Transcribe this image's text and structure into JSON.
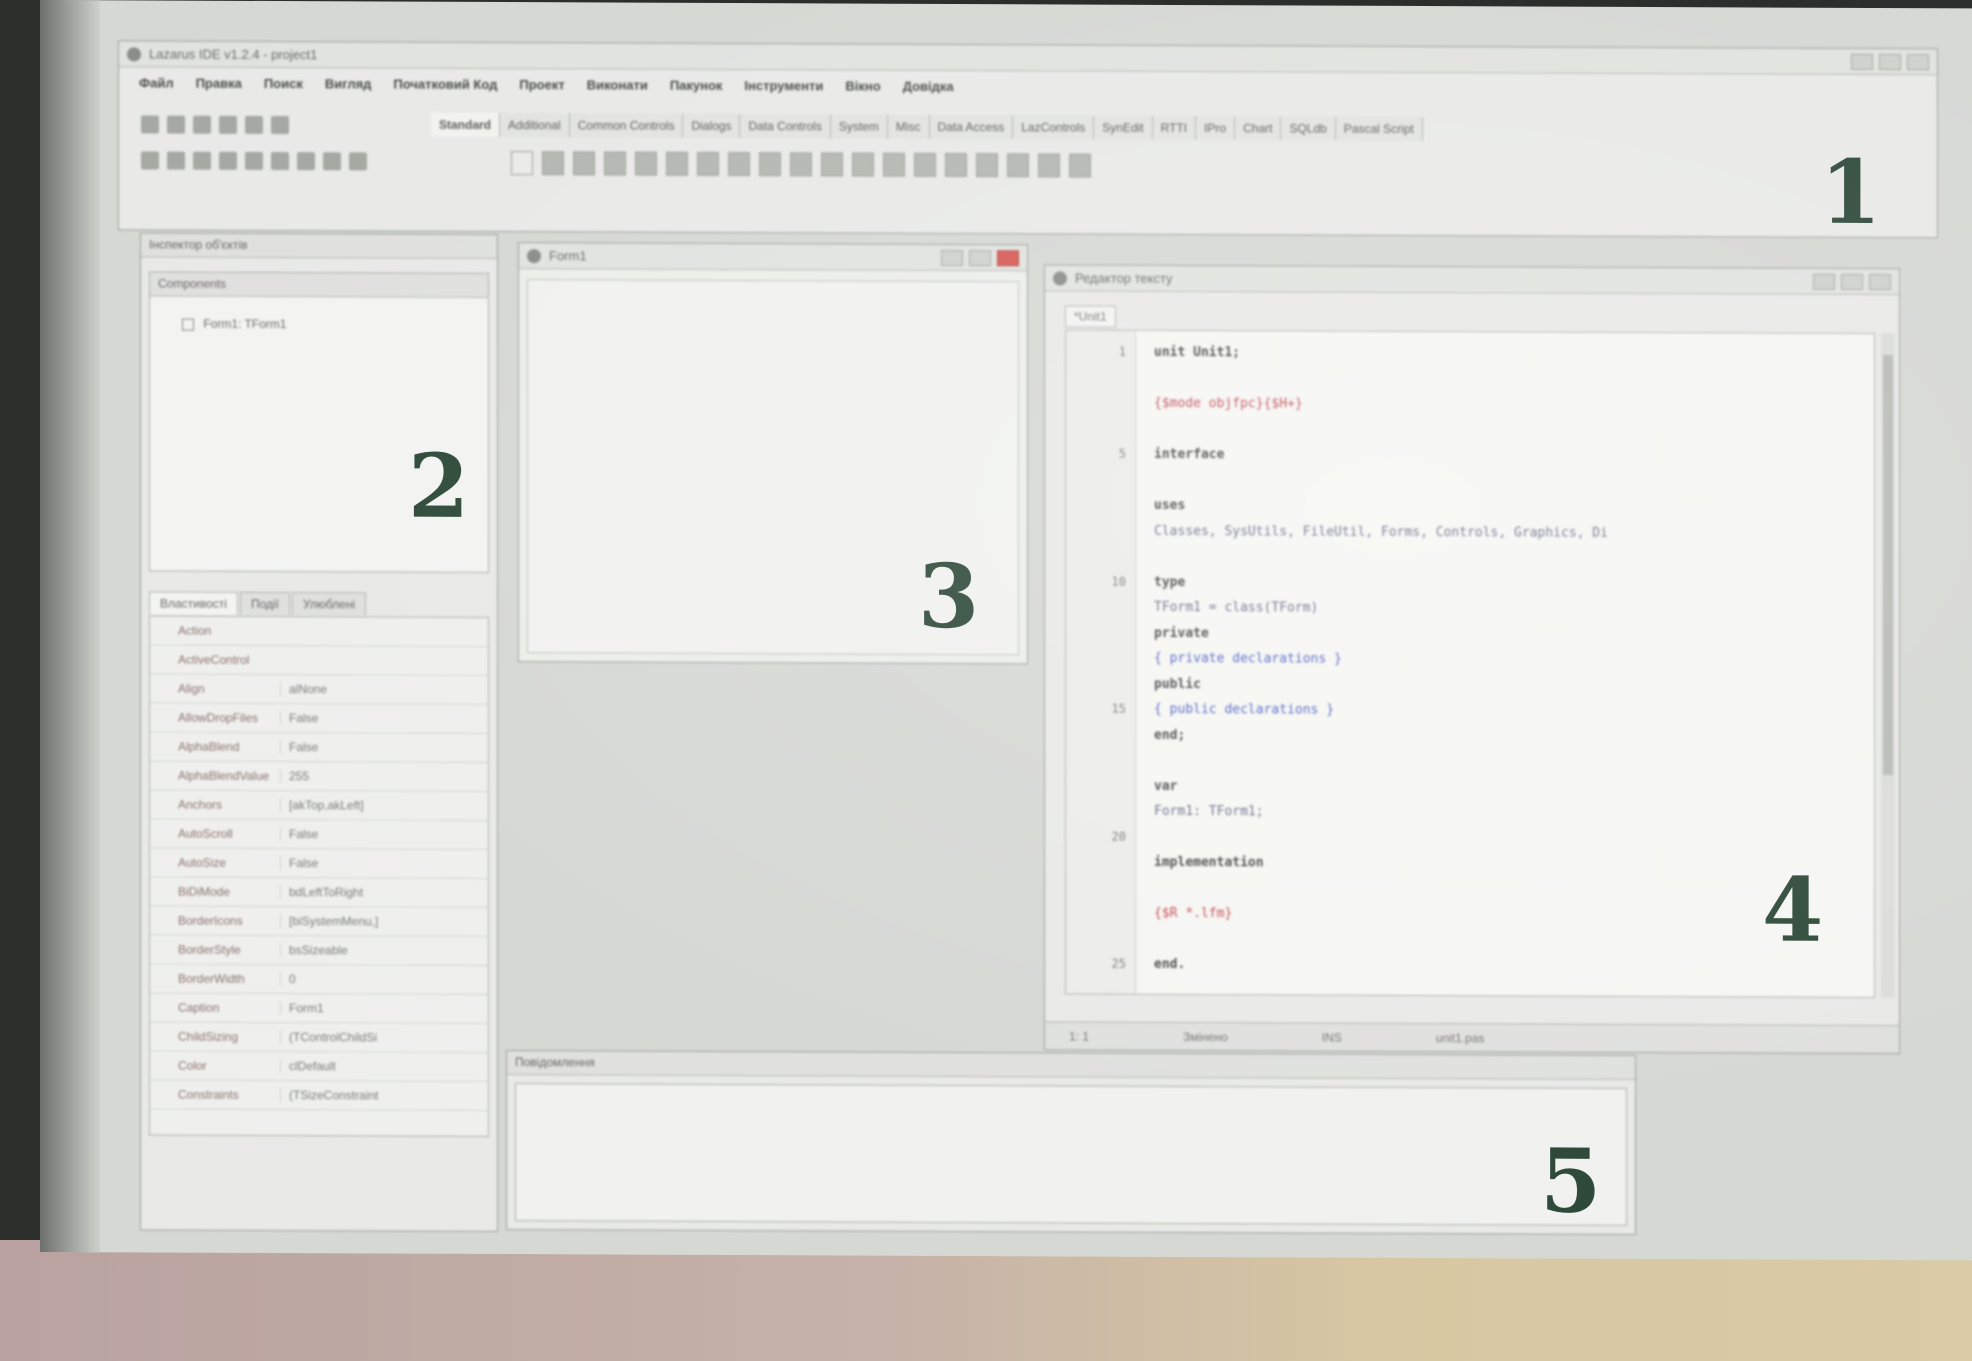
{
  "window": {
    "title": "Lazarus IDE v1.2.4 - project1"
  },
  "menu": [
    "Файл",
    "Правка",
    "Поиск",
    "Вигляд",
    "Початковий Код",
    "Проект",
    "Виконати",
    "Пакунок",
    "Інструменти",
    "Вікно",
    "Довідка"
  ],
  "palette": {
    "tabs": [
      "Standard",
      "Additional",
      "Common Controls",
      "Dialogs",
      "Data Controls",
      "System",
      "Misc",
      "Data Access",
      "LazControls",
      "SynEdit",
      "RTTI",
      "IPro",
      "Chart",
      "SQLdb",
      "Pascal Script"
    ]
  },
  "markers": [
    "1",
    "2",
    "3",
    "4",
    "5"
  ],
  "inspector": {
    "title": "Інспектор об'єктів",
    "components_label": "Components",
    "tree_item": "Form1: TForm1",
    "tabs": [
      "Властивості",
      "Події",
      "Улюблені"
    ],
    "properties": [
      {
        "name": "Action",
        "value": ""
      },
      {
        "name": "ActiveControl",
        "value": ""
      },
      {
        "name": "Align",
        "value": "alNone"
      },
      {
        "name": "AllowDropFiles",
        "value": "False"
      },
      {
        "name": "AlphaBlend",
        "value": "False"
      },
      {
        "name": "AlphaBlendValue",
        "value": "255"
      },
      {
        "name": "Anchors",
        "value": "[akTop,akLeft]"
      },
      {
        "name": "AutoScroll",
        "value": "False"
      },
      {
        "name": "AutoSize",
        "value": "False"
      },
      {
        "name": "BiDiMode",
        "value": "bdLeftToRight"
      },
      {
        "name": "BorderIcons",
        "value": "[biSystemMenu,]"
      },
      {
        "name": "BorderStyle",
        "value": "bsSizeable"
      },
      {
        "name": "BorderWidth",
        "value": "0"
      },
      {
        "name": "Caption",
        "value": "Form1"
      },
      {
        "name": "ChildSizing",
        "value": "(TControlChildSi"
      },
      {
        "name": "Color",
        "value": "clDefault"
      },
      {
        "name": "Constraints",
        "value": "(TSizeConstraint"
      }
    ]
  },
  "form": {
    "title": "Form1"
  },
  "editor": {
    "title": "Редактор тексту",
    "tab": "*Unit1",
    "lines": [
      {
        "n": "1",
        "text": "unit Unit1;",
        "kind": "kw"
      },
      {
        "n": "",
        "text": "",
        "kind": "pl"
      },
      {
        "n": "",
        "text": "{$mode objfpc}{$H+}",
        "kind": "dir"
      },
      {
        "n": "",
        "text": "",
        "kind": "pl"
      },
      {
        "n": "5",
        "text": "interface",
        "kind": "kw"
      },
      {
        "n": "",
        "text": "",
        "kind": "pl"
      },
      {
        "n": "",
        "text": "uses",
        "kind": "kw"
      },
      {
        "n": "",
        "text": "  Classes, SysUtils, FileUtil, Forms, Controls, Graphics, Di",
        "kind": "pl"
      },
      {
        "n": "",
        "text": "",
        "kind": "pl"
      },
      {
        "n": "10",
        "text": "type",
        "kind": "kw"
      },
      {
        "n": "",
        "text": "  TForm1 = class(TForm)",
        "kind": "pl"
      },
      {
        "n": "",
        "text": "  private",
        "kind": "kw"
      },
      {
        "n": "",
        "text": "    { private declarations }",
        "kind": "cm"
      },
      {
        "n": "",
        "text": "  public",
        "kind": "kw"
      },
      {
        "n": "15",
        "text": "    { public declarations }",
        "kind": "cm"
      },
      {
        "n": "",
        "text": "  end;",
        "kind": "kw"
      },
      {
        "n": "",
        "text": "",
        "kind": "pl"
      },
      {
        "n": "",
        "text": "var",
        "kind": "kw"
      },
      {
        "n": "",
        "text": "  Form1: TForm1;",
        "kind": "pl"
      },
      {
        "n": "20",
        "text": "",
        "kind": "pl"
      },
      {
        "n": "",
        "text": "implementation",
        "kind": "kw"
      },
      {
        "n": "",
        "text": "",
        "kind": "pl"
      },
      {
        "n": "",
        "text": "{$R *.lfm}",
        "kind": "dir"
      },
      {
        "n": "",
        "text": "",
        "kind": "pl"
      },
      {
        "n": "25",
        "text": "end.",
        "kind": "kw"
      }
    ],
    "status": [
      "1: 1",
      "Змінено",
      "INS",
      "unit1.pas"
    ]
  },
  "messages": {
    "title": "Повідомлення"
  }
}
